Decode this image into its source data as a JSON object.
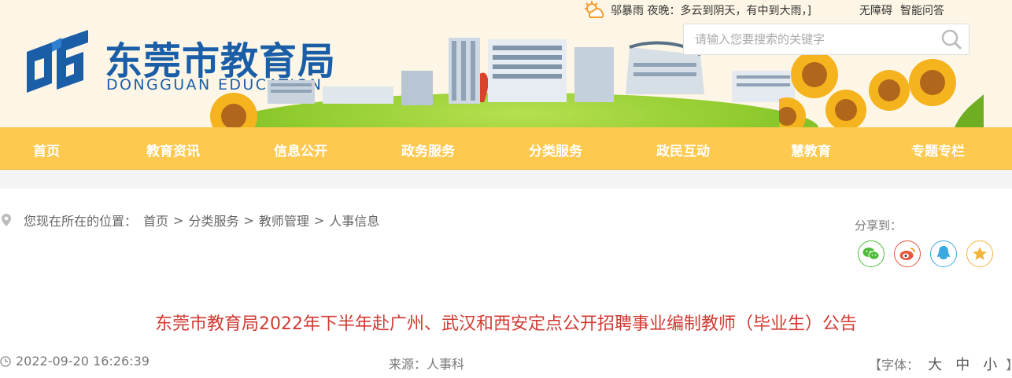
{
  "site": {
    "title": "东莞市教育局",
    "subtitle": "DONGGUAN EDUCATION"
  },
  "topbar": {
    "weather_text": "邬暴雨 夜晚：多云到阴天，有中到大雨，]",
    "accessibility_label": "无障碍",
    "qa_label": "智能问答"
  },
  "search": {
    "placeholder": "请输入您要搜索的关键字"
  },
  "nav": {
    "items": [
      "首页",
      "教育资讯",
      "信息公开",
      "政务服务",
      "分类服务",
      "政民互动",
      "慧教育",
      "专题专栏"
    ]
  },
  "breadcrumb": {
    "prefix": "您现在所在的位置：",
    "items": [
      "首页",
      "分类服务",
      "教师管理",
      "人事信息"
    ],
    "separator": ">"
  },
  "share": {
    "label": "分享到：",
    "buttons": [
      {
        "name": "wechat",
        "color": "#4cbb3a"
      },
      {
        "name": "weibo",
        "color": "#e8553d"
      },
      {
        "name": "qq",
        "color": "#3aa9e0"
      },
      {
        "name": "qzone",
        "color": "#f3b43a"
      }
    ]
  },
  "article": {
    "title": "东莞市教育局2022年下半年赴广州、武汉和西安定点公开招聘事业编制教师（毕业生）公告",
    "datetime": "2022-09-20 16:26:39",
    "source_label": "来源：",
    "source": "人事科",
    "font_label": "【字体：",
    "font_options": [
      "大",
      "中",
      "小"
    ],
    "font_close": "】"
  },
  "colors": {
    "brand_blue": "#1a5ea8",
    "nav_yellow": "#fdc94f",
    "title_red": "#d23a33"
  }
}
